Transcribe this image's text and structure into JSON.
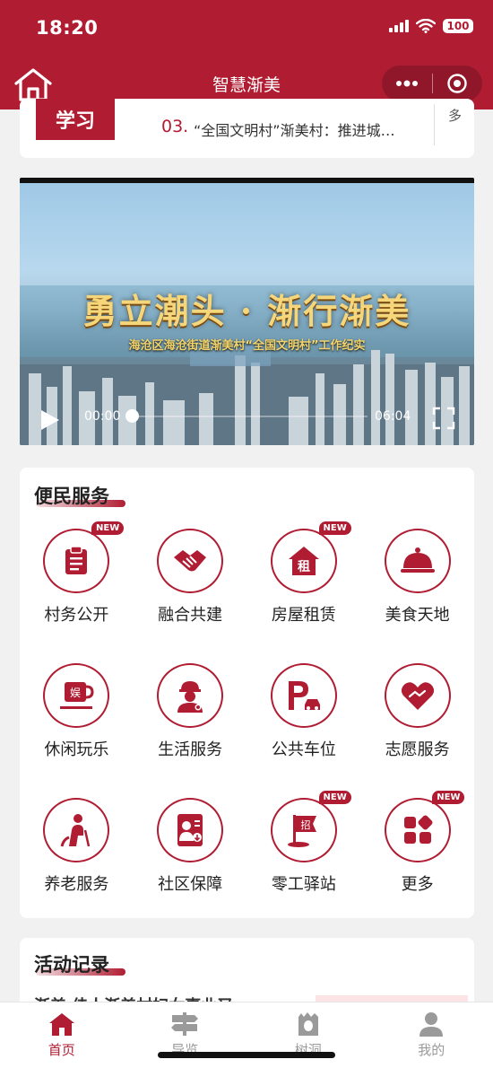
{
  "status_bar": {
    "time": "18:20",
    "battery": "100"
  },
  "nav": {
    "title": "智慧渐美"
  },
  "news": {
    "thumb_text": "学习",
    "number": "03.",
    "text": "“全国文明村”渐美村：推进城…",
    "more": "多"
  },
  "video": {
    "title": "勇立潮头 · 渐行渐美",
    "subtitle": "海沧区海沧街道渐美村“全国文明村”工作纪实",
    "current_time": "00:00",
    "total_time": "06:04",
    "progress": 0
  },
  "services": {
    "title": "便民服务",
    "badge": "NEW",
    "items": [
      {
        "label": "村务公开",
        "icon": "clipboard-icon",
        "new": true
      },
      {
        "label": "融合共建",
        "icon": "handshake-icon",
        "new": false
      },
      {
        "label": "房屋租赁",
        "icon": "house-rent-icon",
        "new": true,
        "glyph": "租"
      },
      {
        "label": "美食天地",
        "icon": "food-cloche-icon",
        "new": false
      },
      {
        "label": "休闲玩乐",
        "icon": "entertainment-cup-icon",
        "new": false,
        "glyph": "娱"
      },
      {
        "label": "生活服务",
        "icon": "worker-icon",
        "new": false
      },
      {
        "label": "公共车位",
        "icon": "parking-icon",
        "new": false
      },
      {
        "label": "志愿服务",
        "icon": "heart-hands-icon",
        "new": false
      },
      {
        "label": "养老服务",
        "icon": "elderly-icon",
        "new": false
      },
      {
        "label": "社区保障",
        "icon": "security-card-icon",
        "new": false
      },
      {
        "label": "零工驿站",
        "icon": "recruit-flag-icon",
        "new": true,
        "glyph": "招"
      },
      {
        "label": "更多",
        "icon": "grid-more-icon",
        "new": true
      }
    ]
  },
  "activity": {
    "title": "活动记录",
    "peek": "渐美 佳人渐美村妇女事业又"
  },
  "tabbar": {
    "items": [
      {
        "label": "首页",
        "icon": "home-icon",
        "active": true
      },
      {
        "label": "导览",
        "icon": "signpost-icon",
        "active": false
      },
      {
        "label": "树洞",
        "icon": "tree-hole-icon",
        "active": false
      },
      {
        "label": "我的",
        "icon": "user-icon",
        "active": false
      }
    ]
  },
  "colors": {
    "brand": "#b01d33",
    "inactive": "#9a9a9a",
    "background": "#f1f1f1"
  }
}
